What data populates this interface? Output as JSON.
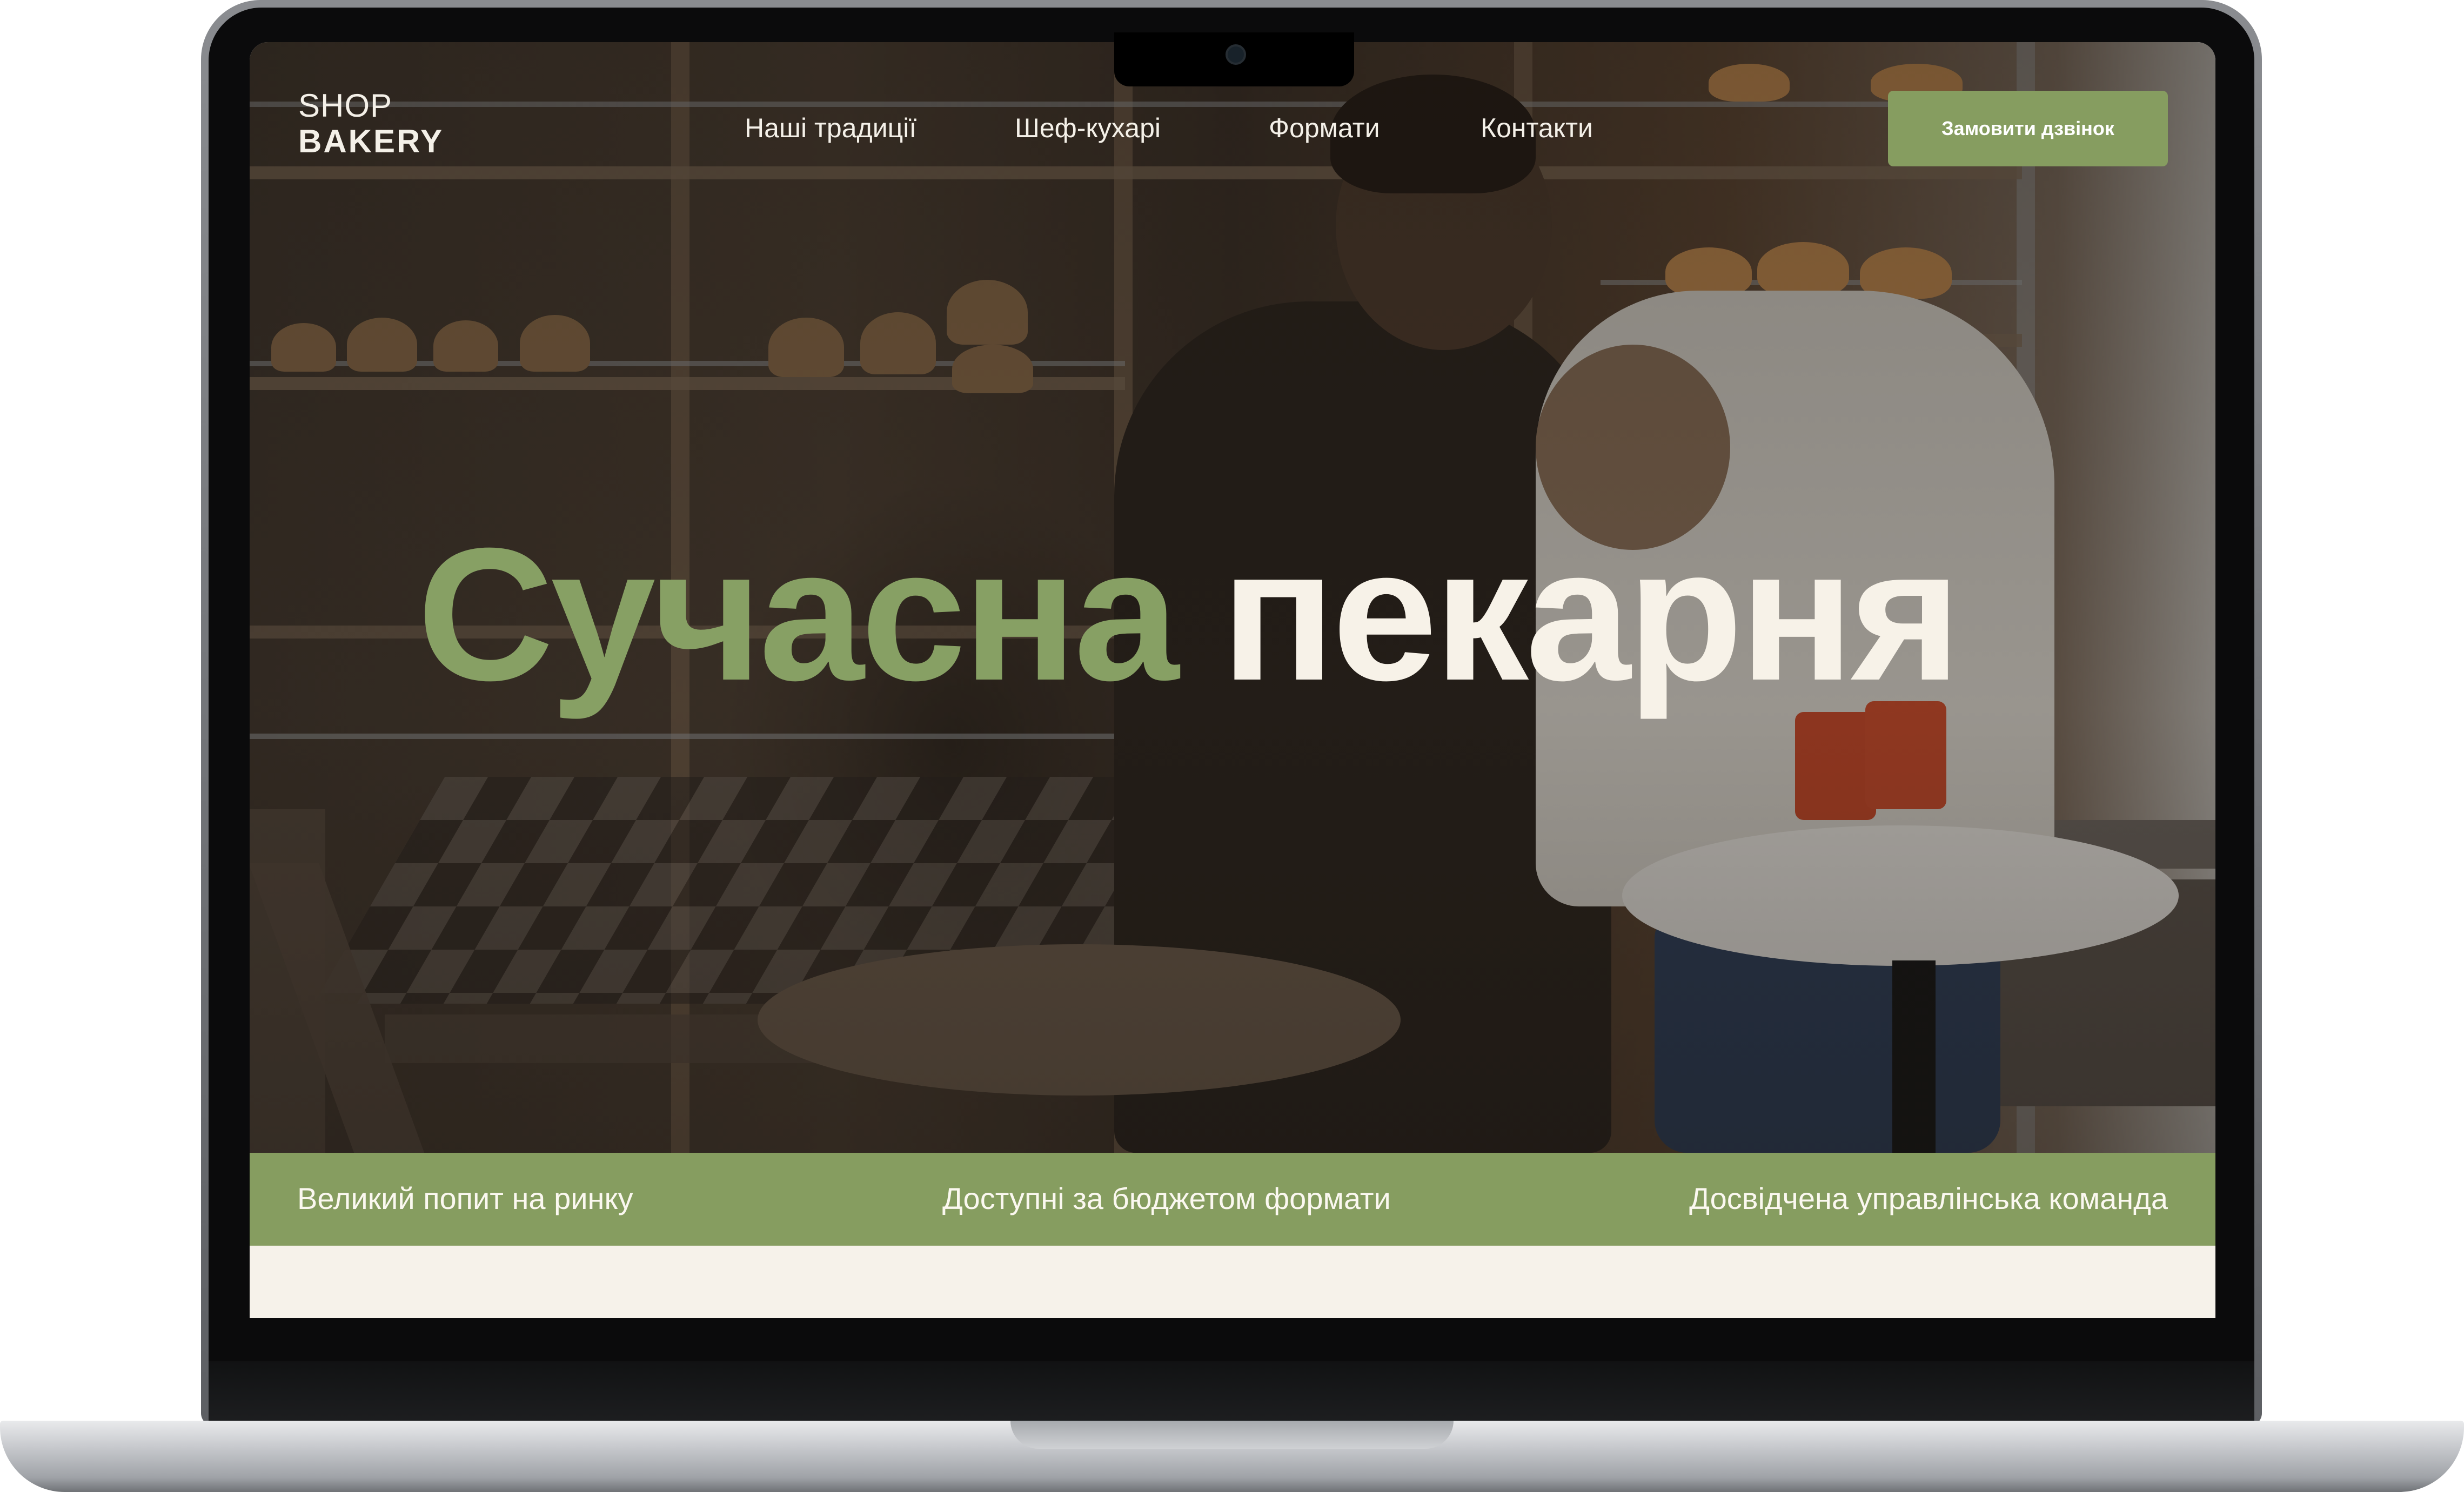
{
  "colors": {
    "accent_green": "#869d60",
    "headline_green": "#87a064",
    "light_text": "#f7f2e8",
    "cream": "#f6f2ea"
  },
  "header": {
    "logo_top": "SHOP",
    "logo_bottom": "BAKERY",
    "nav": [
      {
        "label": "Наші традиції"
      },
      {
        "label": "Шеф-кухарі"
      },
      {
        "label": "Формати"
      },
      {
        "label": "Контакти"
      }
    ],
    "cta_label": "Замовити дзвінок"
  },
  "hero": {
    "headline_part1": "Сучасна",
    "headline_part2": "пекарня"
  },
  "features": [
    {
      "label": "Великий попит на ринку"
    },
    {
      "label": "Доступні за бюджетом формати"
    },
    {
      "label": "Досвідчена управлінська команда"
    }
  ]
}
